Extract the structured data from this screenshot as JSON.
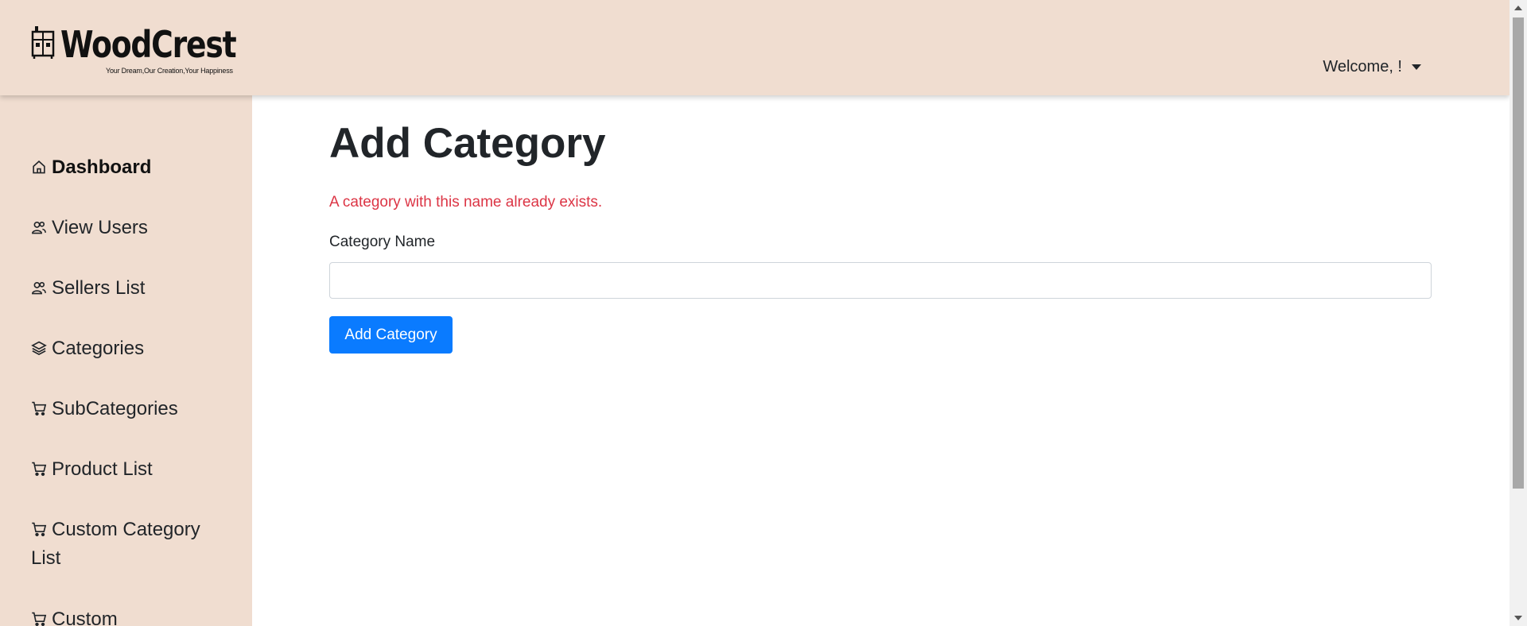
{
  "brand": {
    "name": "WoodCrest",
    "tagline": "Your Dream,Our Creation,Your Happiness"
  },
  "header": {
    "welcome": "Welcome, !"
  },
  "sidebar": {
    "items": [
      {
        "label": "Dashboard",
        "icon": "home-icon",
        "active": true
      },
      {
        "label": "View Users",
        "icon": "users-icon"
      },
      {
        "label": "Sellers List",
        "icon": "users-icon"
      },
      {
        "label": "Categories",
        "icon": "layers-icon"
      },
      {
        "label": "SubCategories",
        "icon": "cart-icon"
      },
      {
        "label": "Product List",
        "icon": "cart-icon"
      },
      {
        "label": "Custom Category List",
        "icon": "cart-icon"
      },
      {
        "label": "Custom",
        "icon": "cart-icon"
      }
    ]
  },
  "main": {
    "title": "Add Category",
    "error": "A category with this name already exists.",
    "field_label": "Category Name",
    "field_value": "",
    "submit_label": "Add Category"
  },
  "colors": {
    "sidebar_bg": "#f0ddd0",
    "primary": "#0a7bff",
    "error": "#dc3545"
  }
}
